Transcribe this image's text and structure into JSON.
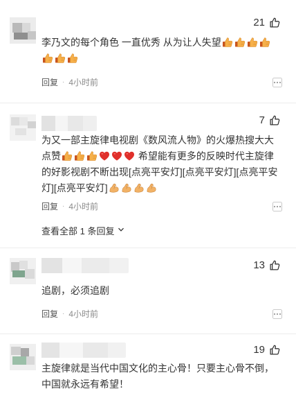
{
  "comments": [
    {
      "likes": "21",
      "text": "李乃文的每个角色 一直优秀 从为让人失望",
      "reply_label": "回复",
      "time": "4小时前"
    },
    {
      "likes": "7",
      "text_1": "为又一部主旋律电视剧《数风流人物》的火爆热搜大大点赞",
      "text_2": " 希望能有更多的反映时代主旋律的好影视剧不断出现",
      "text_3": "[点亮平安灯][点亮平安灯][点亮平安灯][点亮平安灯]",
      "reply_label": "回复",
      "time": "4小时前",
      "view_replies": "查看全部 1 条回复"
    },
    {
      "likes": "13",
      "text": "追剧，必须追剧",
      "reply_label": "回复",
      "time": "4小时前"
    },
    {
      "likes": "19",
      "text": "主旋律就是当代中国文化的主心骨！只要主心骨不倒，中国就永远有希望！"
    }
  ],
  "icons": {
    "like": "thumbs-up-outline-icon",
    "more": "more-dots-icon",
    "emoji_thumb": "thumbs-up-emoji",
    "emoji_heart": "red-heart-emoji",
    "emoji_muscle": "flexed-biceps-emoji",
    "chevron": "chevron-down-icon"
  },
  "colors": {
    "heart": "#e0302b",
    "thumb": "#f0a03a",
    "muscle": "#f2b266",
    "text": "#333333",
    "meta": "#8a8a8a"
  },
  "separator": "·"
}
